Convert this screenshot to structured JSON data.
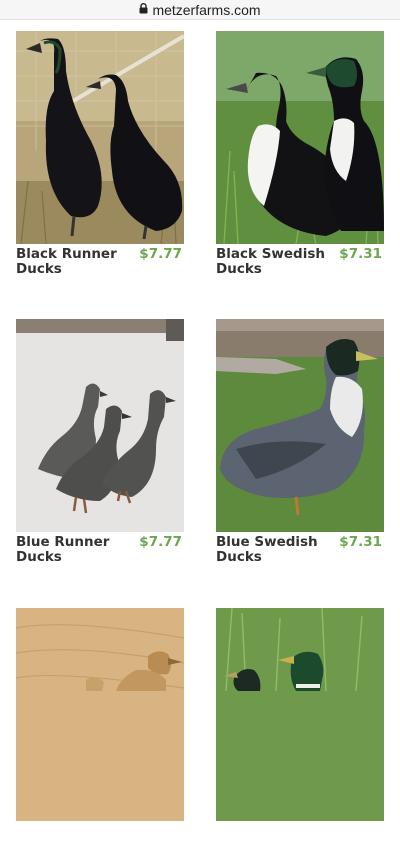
{
  "browser": {
    "url": "metzerfarms.com"
  },
  "products": [
    {
      "name": "Black Runner Ducks",
      "price": "$7.77",
      "icon": "black-runner-duck-photo"
    },
    {
      "name": "Black Swedish Ducks",
      "price": "$7.31",
      "icon": "black-swedish-duck-photo"
    },
    {
      "name": "Blue Runner Ducks",
      "price": "$7.77",
      "icon": "blue-runner-duck-photo"
    },
    {
      "name": "Blue Swedish Ducks",
      "price": "$7.31",
      "icon": "blue-swedish-duck-photo"
    },
    {
      "name": "",
      "price": "",
      "icon": "duckling-photo"
    },
    {
      "name": "",
      "price": "",
      "icon": "mallard-duck-photo"
    }
  ],
  "colors": {
    "price": "#6aa84f",
    "text": "#333333"
  }
}
